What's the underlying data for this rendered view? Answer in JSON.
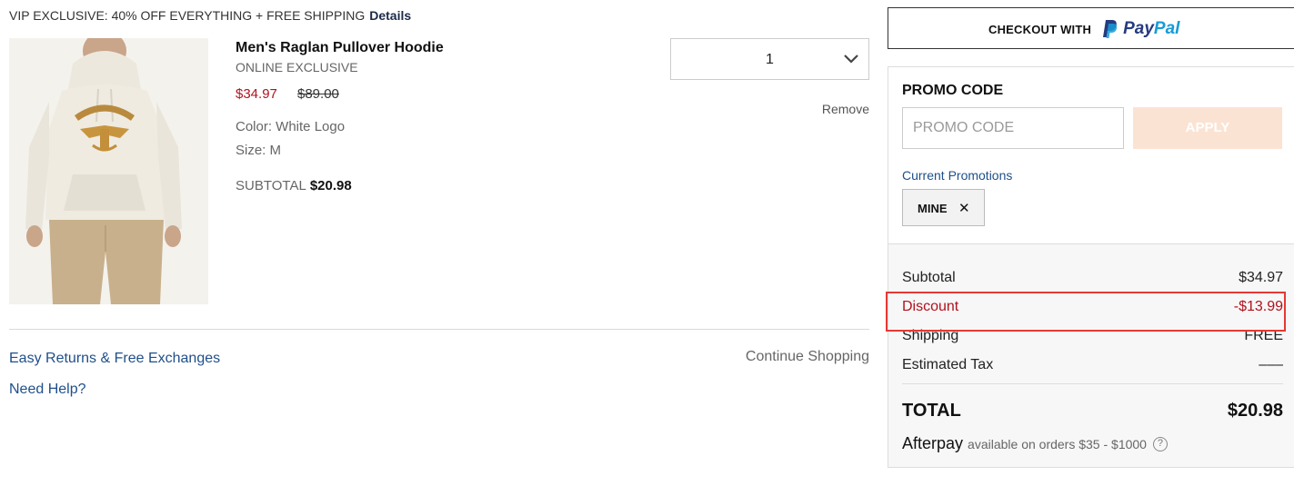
{
  "banner": {
    "text": "VIP EXCLUSIVE: 40% OFF EVERYTHING + FREE SHIPPING",
    "details_label": "Details"
  },
  "product": {
    "name": "Men's Raglan Pullover Hoodie",
    "tag": "ONLINE EXCLUSIVE",
    "sale_price": "$34.97",
    "original_price": "$89.00",
    "color": "Color: White Logo",
    "size": "Size: M",
    "subtotal_label": "SUBTOTAL",
    "subtotal_value": "$20.98",
    "quantity": "1",
    "remove_label": "Remove",
    "image_icon": "hoodie-product-photo"
  },
  "footer": {
    "easy_returns": "Easy Returns & Free Exchanges",
    "need_help": "Need Help?",
    "continue_shopping": "Continue Shopping"
  },
  "checkout": {
    "paypal_prefix": "CHECKOUT WITH",
    "paypal_pay": "Pay",
    "paypal_pal": "Pal"
  },
  "promo": {
    "title": "PROMO CODE",
    "input_placeholder": "PROMO CODE",
    "apply_label": "APPLY",
    "current_label": "Current Promotions",
    "applied_code": "MINE",
    "remove_icon": "close-icon"
  },
  "summary": {
    "subtotal_label": "Subtotal",
    "subtotal_value": "$34.97",
    "discount_label": "Discount",
    "discount_value": "-$13.99",
    "shipping_label": "Shipping",
    "shipping_value": "FREE",
    "tax_label": "Estimated Tax",
    "tax_value": "–––",
    "total_label": "TOTAL",
    "total_value": "$20.98",
    "afterpay_brand": "Afterpay",
    "afterpay_note": "available on orders $35 - $1000",
    "afterpay_help": "?"
  },
  "colors": {
    "sale_red": "#b1121d",
    "link_blue": "#1f4f8a",
    "apply_disabled": "#fbe3d3",
    "highlight": "#e53935"
  }
}
